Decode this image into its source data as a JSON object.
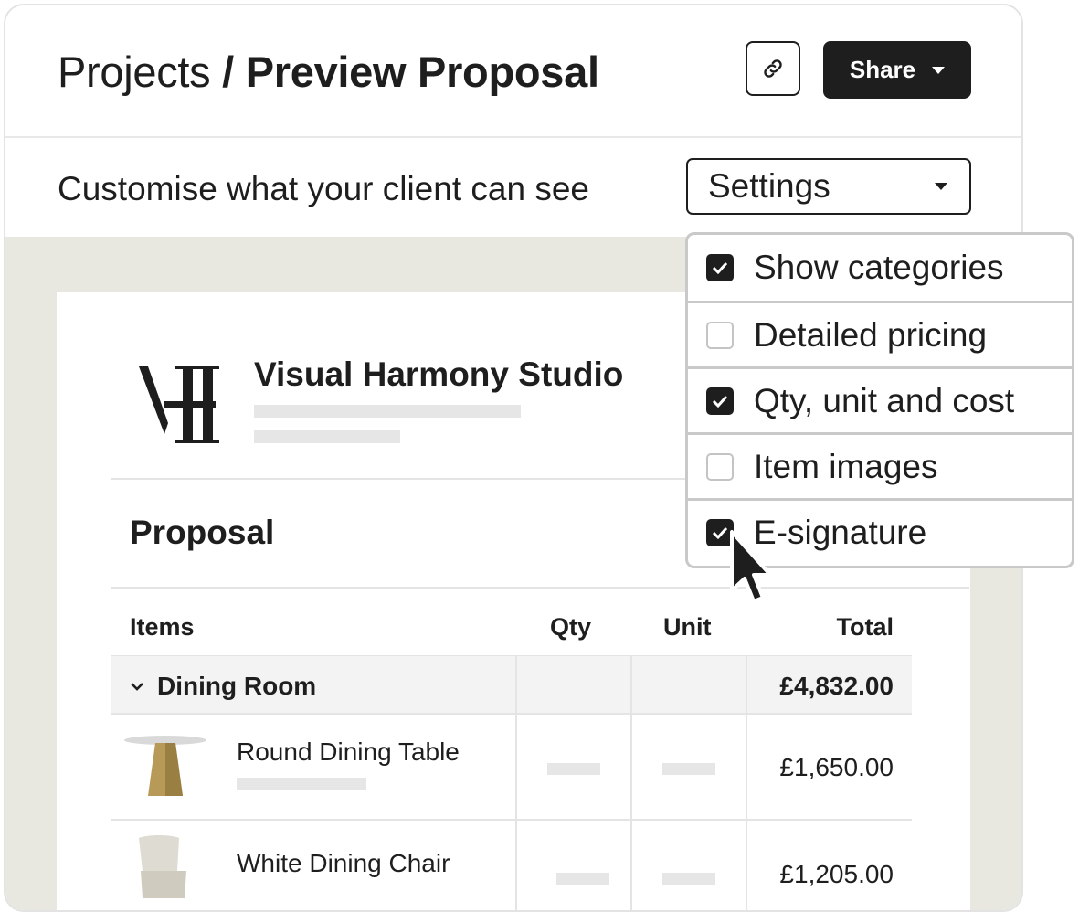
{
  "header": {
    "breadcrumb_parent": "Projects",
    "separator": "/",
    "page_title": "Preview Proposal",
    "share_label": "Share"
  },
  "toolbar": {
    "label": "Customise what your client can see",
    "settings_label": "Settings"
  },
  "settings_menu": {
    "options": [
      {
        "label": "Show categories",
        "checked": true
      },
      {
        "label": "Detailed pricing",
        "checked": false
      },
      {
        "label": "Qty, unit and cost",
        "checked": true
      },
      {
        "label": "Item images",
        "checked": false
      },
      {
        "label": "E-signature",
        "checked": true
      }
    ]
  },
  "document": {
    "studio_name": "Visual Harmony Studio",
    "proposal_title": "Proposal",
    "columns": [
      "Items",
      "Qty",
      "Unit",
      "Total"
    ],
    "group": {
      "name": "Dining Room",
      "total": "£4,832.00"
    },
    "items": [
      {
        "name": "Round Dining Table",
        "total": "£1,650.00"
      },
      {
        "name": "White Dining Chair",
        "total": "£1,205.00"
      }
    ]
  },
  "colors": {
    "primary_dark": "#1e1e1e",
    "canvas_background": "#e8e7e0",
    "placeholder": "#e6e6e6",
    "border": "#c9c9c9"
  }
}
